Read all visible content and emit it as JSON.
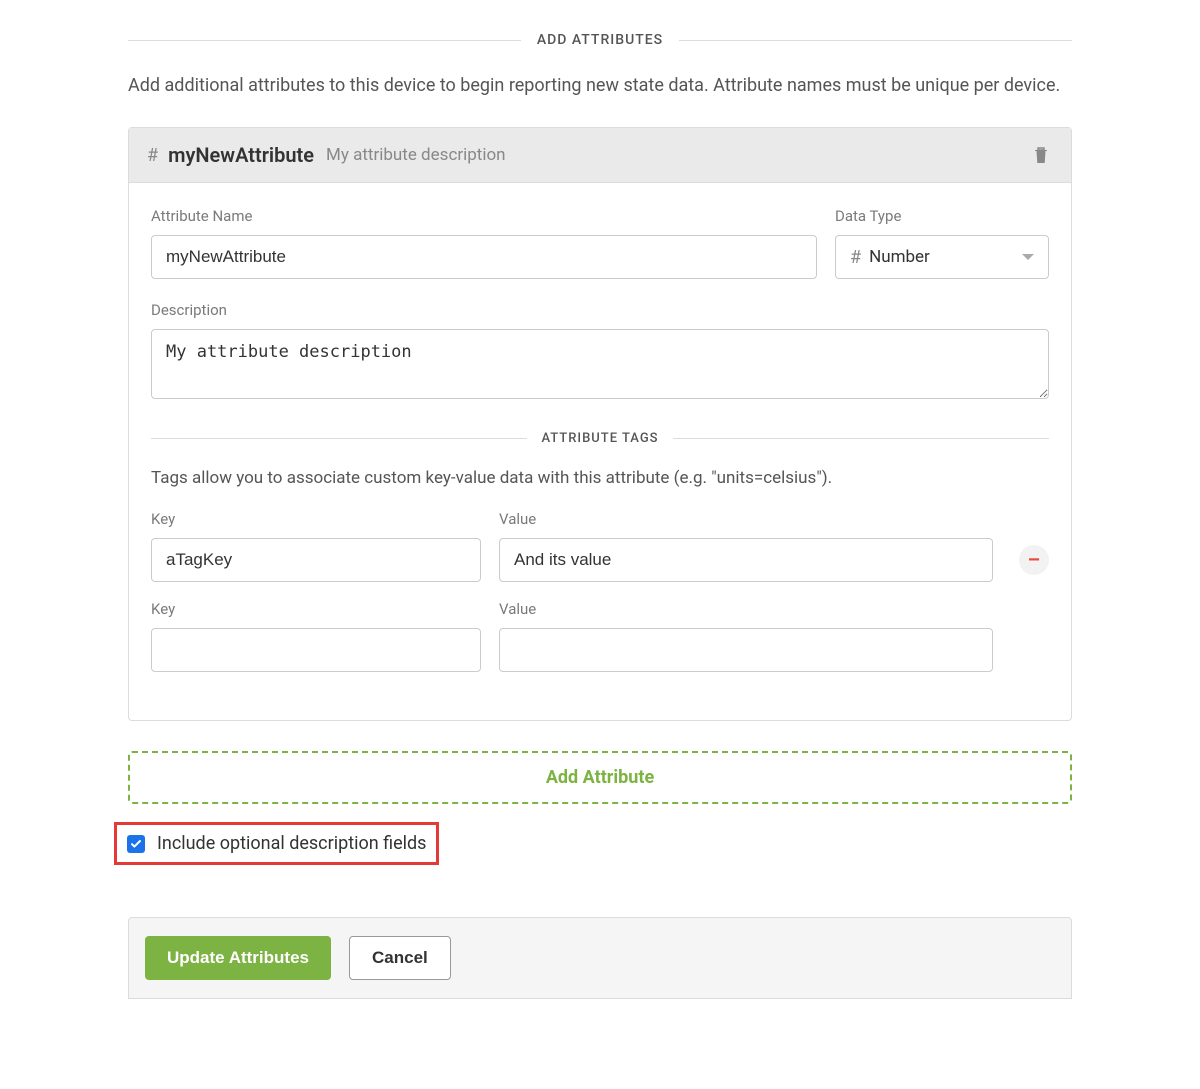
{
  "section": {
    "title": "ADD ATTRIBUTES",
    "intro": "Add additional attributes to this device to begin reporting new state data. Attribute names must be unique per device."
  },
  "attribute": {
    "header_name": "myNewAttribute",
    "header_desc": "My attribute description",
    "fields": {
      "name_label": "Attribute Name",
      "name_value": "myNewAttribute",
      "data_type_label": "Data Type",
      "data_type_value": "Number",
      "description_label": "Description",
      "description_value": "My attribute description"
    },
    "tags_section": {
      "title": "ATTRIBUTE TAGS",
      "desc": "Tags allow you to associate custom key-value data with this attribute (e.g. \"units=celsius\").",
      "key_label": "Key",
      "value_label": "Value",
      "rows": [
        {
          "key": "aTagKey",
          "value": "And its value"
        },
        {
          "key": "",
          "value": ""
        }
      ]
    }
  },
  "add_attribute_label": "Add Attribute",
  "include_optional": {
    "checked": true,
    "label": "Include optional description fields"
  },
  "footer": {
    "update": "Update Attributes",
    "cancel": "Cancel"
  }
}
